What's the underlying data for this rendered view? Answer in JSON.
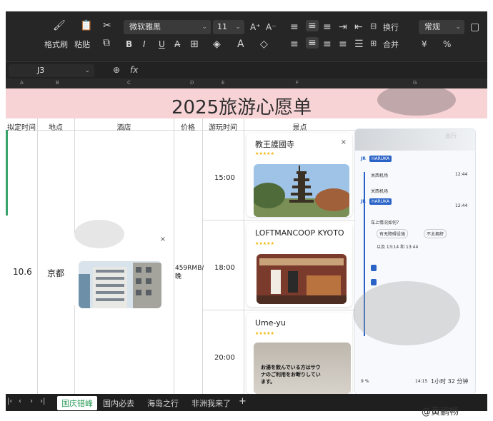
{
  "toolbar": {
    "format_painter": "格式刷",
    "paste": "粘贴",
    "font_name": "微软雅黑",
    "font_size": "11",
    "wrap": "换行",
    "merge": "合并",
    "number_format": "常规",
    "bold": "B",
    "italic": "I",
    "underline": "U",
    "strike": "A̶",
    "increase_font": "A⁺",
    "decrease_font": "A⁻",
    "currency": "¥",
    "percent": "%",
    "fx": "fx"
  },
  "formula_bar": {
    "cell_ref": "J3"
  },
  "columns": [
    "A",
    "B",
    "C",
    "D",
    "E",
    "F",
    "G"
  ],
  "sheet": {
    "title": "2025旅游心愿单",
    "headers": [
      "拟定时间",
      "地点",
      "酒店",
      "价格",
      "游玩时间",
      "景点"
    ],
    "date": "10.6",
    "location": "京都",
    "price": "459RMB/晚",
    "times": [
      "15:00",
      "18:00",
      "20:00"
    ],
    "attractions": [
      {
        "name": "教王護國寺",
        "rating": "★★★★★"
      },
      {
        "name": "LOFTMANCOOP KYOTO",
        "rating": "★★★★★"
      },
      {
        "name": "Ume-yu",
        "rating": "★★★★★"
      }
    ],
    "umeyu_sign": "お湯を飲んでいる方はサウナのご利用をお断りしています。"
  },
  "phone": {
    "header": "出行",
    "train_badge": "HARUKA",
    "station_1": "关西机场",
    "station_1_time": "12:44",
    "station_2": "关西机场",
    "station_2_time": "12:44",
    "jr": "JR",
    "route_question": "车上情况如何？",
    "option_1": "有无障碍设施",
    "option_2": "不太拥挤",
    "between": "以及 13:14 和 13:44",
    "duration": "1小时 32 分钟",
    "arrive": "14:15",
    "walk": "9 %"
  },
  "tabs": [
    "国庆错峰",
    "国内必去",
    "海岛之行",
    "非洲我来了",
    "+"
  ],
  "active_tab": "国庆错峰",
  "watermark": "@黄鹂畅"
}
